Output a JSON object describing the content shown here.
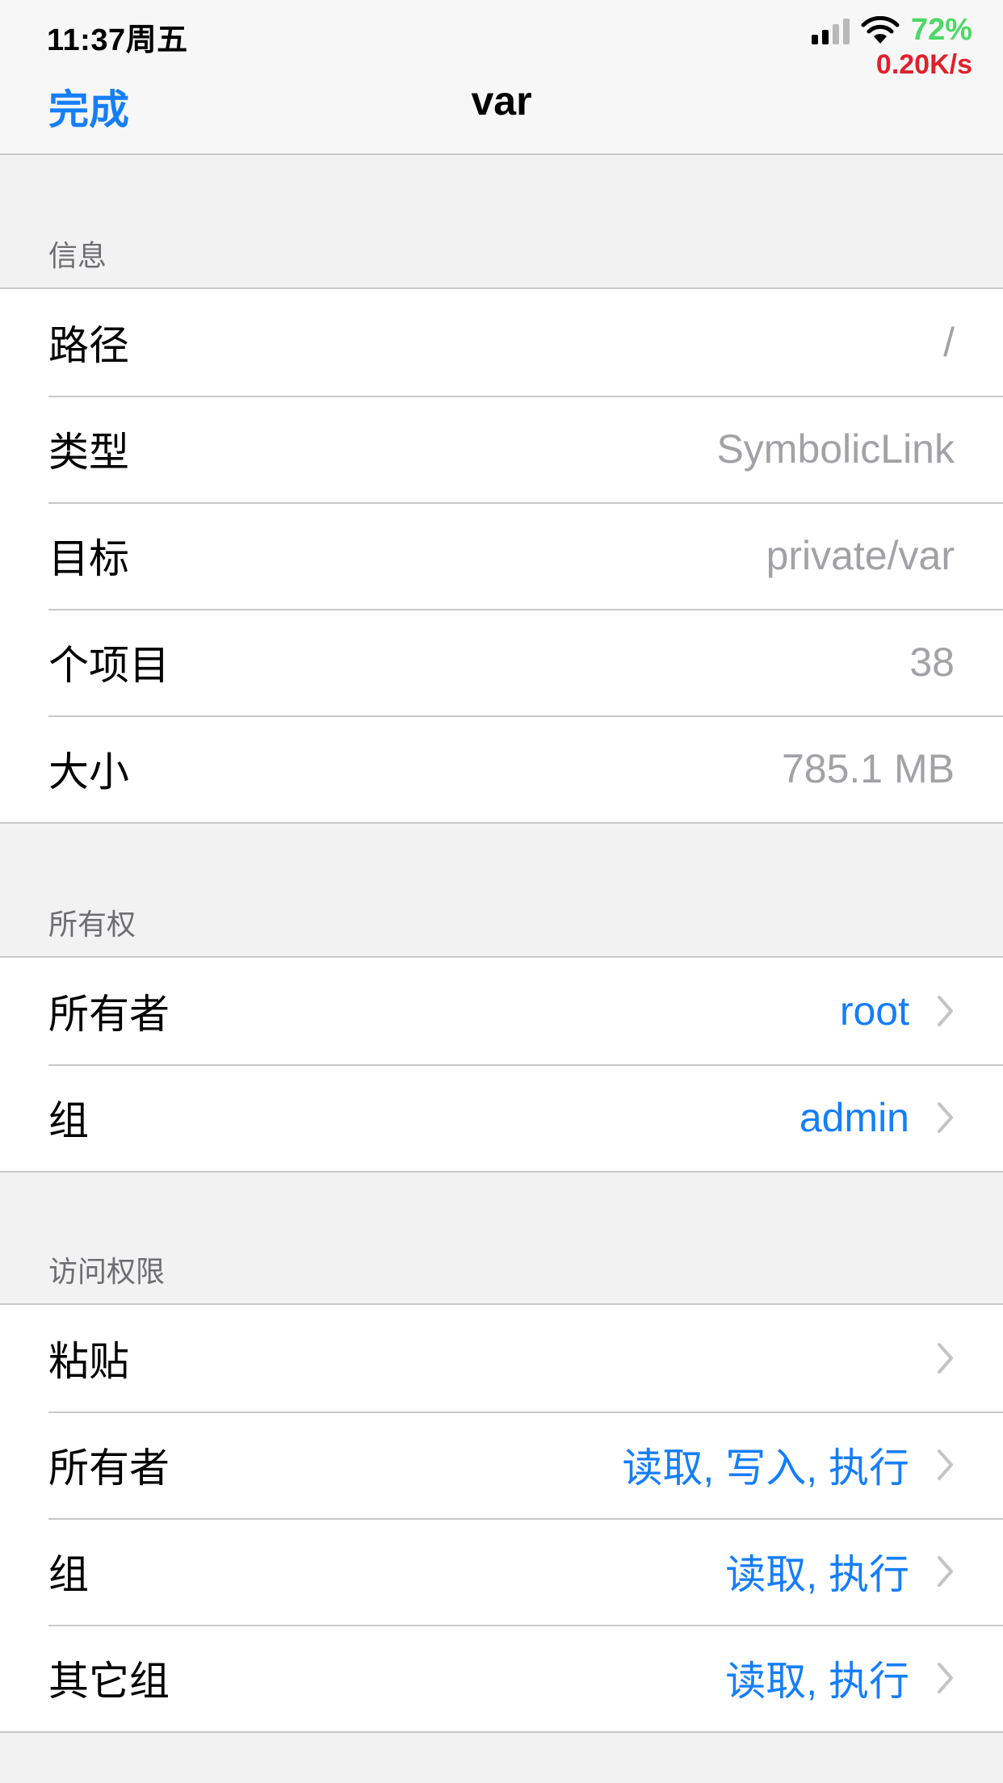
{
  "status_bar": {
    "time": "11:37周五",
    "battery_percent": "72%",
    "net_speed": "0.20K/s",
    "signal_bars": 2,
    "colors": {
      "battery": "#4cd964",
      "net_speed": "#e0202a"
    }
  },
  "nav": {
    "done_label": "完成",
    "title": "var",
    "accent": "#157efb"
  },
  "sections": {
    "info": {
      "header": "信息",
      "rows": [
        {
          "label": "路径",
          "value": "/"
        },
        {
          "label": "类型",
          "value": "SymbolicLink"
        },
        {
          "label": "目标",
          "value": "private/var"
        },
        {
          "label": "个项目",
          "value": "38"
        },
        {
          "label": "大小",
          "value": "785.1 MB"
        }
      ]
    },
    "ownership": {
      "header": "所有权",
      "rows": [
        {
          "label": "所有者",
          "value": "root"
        },
        {
          "label": "组",
          "value": "admin"
        }
      ]
    },
    "permissions": {
      "header": "访问权限",
      "rows": [
        {
          "label": "粘贴",
          "value": ""
        },
        {
          "label": "所有者",
          "value": "读取, 写入, 执行"
        },
        {
          "label": "组",
          "value": "读取, 执行"
        },
        {
          "label": "其它组",
          "value": "读取, 执行"
        }
      ]
    }
  },
  "icons": {
    "wifi": "wifi-icon",
    "signal": "cellular-signal-icon",
    "chevron": "chevron-right-icon"
  }
}
